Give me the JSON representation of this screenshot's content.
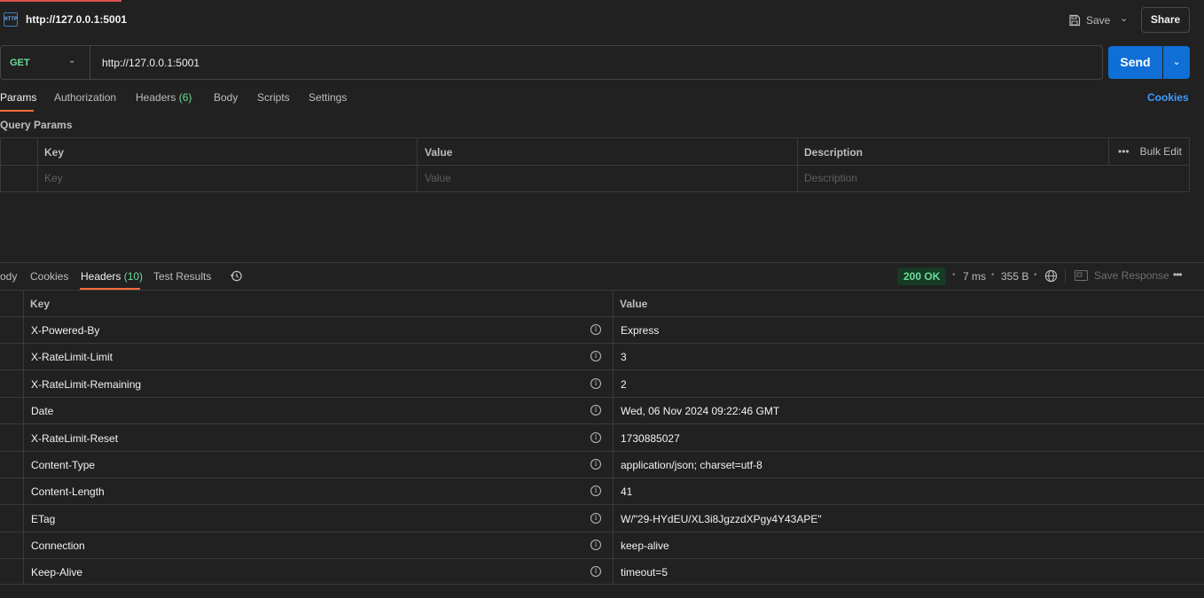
{
  "tab": {
    "title": "http://127.0.0.1:5001",
    "icon": "http-icon"
  },
  "toolbar": {
    "save_label": "Save",
    "share_label": "Share"
  },
  "request": {
    "method": "GET",
    "url": "http://127.0.0.1:5001",
    "send_label": "Send"
  },
  "req_tabs": {
    "params": "Params",
    "authorization": "Authorization",
    "headers": "Headers",
    "headers_count": "(6)",
    "body": "Body",
    "scripts": "Scripts",
    "settings": "Settings",
    "cookies": "Cookies"
  },
  "query_params": {
    "title": "Query Params",
    "col_key": "Key",
    "col_value": "Value",
    "col_description": "Description",
    "bulk_edit": "Bulk Edit",
    "placeholder_key": "Key",
    "placeholder_value": "Value",
    "placeholder_description": "Description"
  },
  "response": {
    "tabs": {
      "body": "ody",
      "cookies": "Cookies",
      "headers": "Headers",
      "headers_count": "(10)",
      "test_results": "Test Results"
    },
    "status": "200 OK",
    "time": "7 ms",
    "size": "355 B",
    "save_response": "Save Response",
    "col_key": "Key",
    "col_value": "Value",
    "headers": [
      {
        "key": "X-Powered-By",
        "value": "Express"
      },
      {
        "key": "X-RateLimit-Limit",
        "value": "3"
      },
      {
        "key": "X-RateLimit-Remaining",
        "value": "2"
      },
      {
        "key": "Date",
        "value": "Wed, 06 Nov 2024 09:22:46 GMT"
      },
      {
        "key": "X-RateLimit-Reset",
        "value": "1730885027"
      },
      {
        "key": "Content-Type",
        "value": "application/json; charset=utf-8"
      },
      {
        "key": "Content-Length",
        "value": "41"
      },
      {
        "key": "ETag",
        "value": "W/\"29-HYdEU/XL3i8JgzzdXPgy4Y43APE\""
      },
      {
        "key": "Connection",
        "value": "keep-alive"
      },
      {
        "key": "Keep-Alive",
        "value": "timeout=5"
      }
    ]
  },
  "colors": {
    "accent_orange": "#ff6c37",
    "send_blue": "#0f6fd6",
    "get_green": "#6bdd9a",
    "link_blue": "#3b9dff"
  }
}
